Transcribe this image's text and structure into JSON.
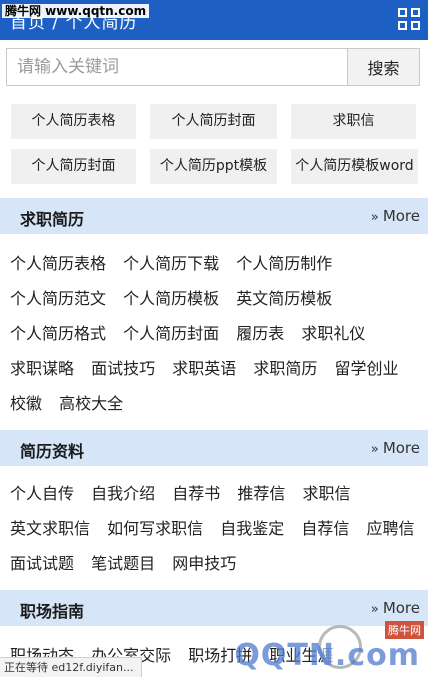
{
  "header": {
    "title": "首页 / 个人简历",
    "watermark": "腾牛网 www.qqtn.com",
    "menu_icon": "grid-icon"
  },
  "search": {
    "placeholder": "请输入关键词",
    "value": "",
    "button_label": "搜索"
  },
  "hot_tags": [
    "个人简历表格",
    "个人简历封面",
    "求职信",
    "个人简历封面",
    "个人简历ppt模板",
    "个人简历模板word"
  ],
  "sections": [
    {
      "title": "求职简历",
      "more": "More",
      "rows": [
        [
          "个人简历表格",
          "个人简历下载",
          "个人简历制作"
        ],
        [
          "个人简历范文",
          "个人简历模板",
          "英文简历模板"
        ],
        [
          "个人简历格式",
          "个人简历封面",
          "履历表",
          "求职礼仪"
        ],
        [
          "求职谋略",
          "面试技巧",
          "求职英语",
          "求职简历",
          "留学创业"
        ],
        [
          "校徽",
          "高校大全"
        ]
      ]
    },
    {
      "title": "简历资料",
      "more": "More",
      "rows": [
        [
          "个人自传",
          "自我介绍",
          "自荐书",
          "推荐信",
          "求职信"
        ],
        [
          "英文求职信",
          "如何写求职信",
          "自我鉴定",
          "自荐信",
          "应聘信"
        ],
        [
          "面试试题",
          "笔试题目",
          "网申技巧"
        ]
      ]
    },
    {
      "title": "职场指南",
      "more": "More",
      "rows": [
        [
          "职场动态",
          "办公室交际",
          "职场打拼",
          "职业生涯"
        ]
      ]
    }
  ],
  "status": {
    "text": "正在等待 ed12f.diyifan..."
  },
  "brand_watermark": {
    "text": "QQTN.com",
    "badge": "腾牛网"
  },
  "colors": {
    "header_bg": "#1e5fc4",
    "section_bg": "#d6e5f7",
    "tag_bg": "#f0f0f0"
  }
}
